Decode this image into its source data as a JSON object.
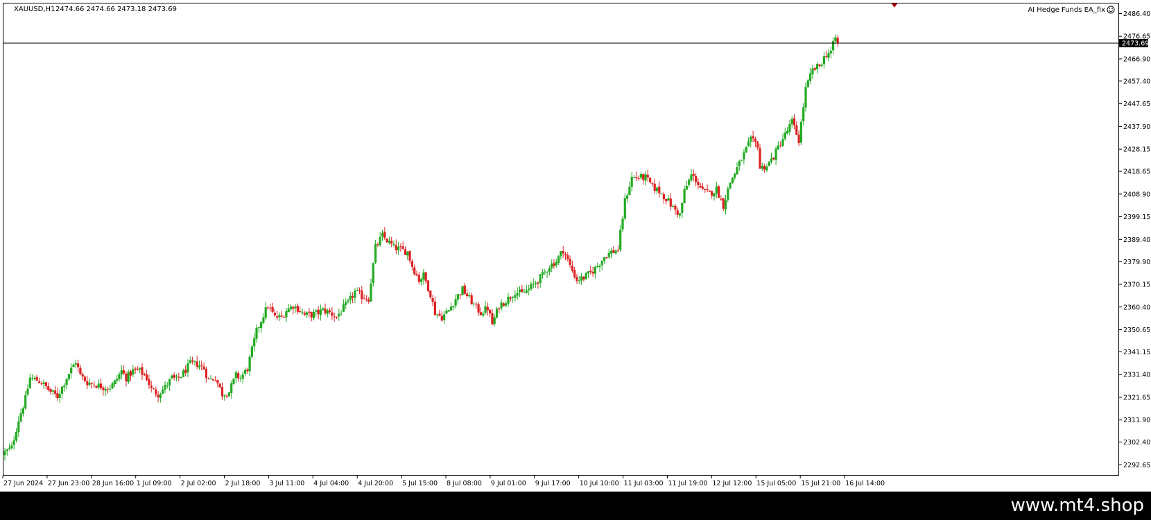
{
  "header": {
    "symbol": "XAUUSD,H1",
    "ohlc": "2474.66 2474.66 2473.18 2473.69",
    "ea_label": "AI Hedge Funds EA_fix",
    "smiley_icon": "smiley-face-icon"
  },
  "footer": {
    "watermark": "www.mt4.shop"
  },
  "colors": {
    "bull": "#22aa22",
    "bear": "#dd2222",
    "background": "#ffffff",
    "axis": "#000000",
    "price_label_bg": "#000000"
  },
  "chart_data": {
    "type": "candlestick",
    "timeframe": "H1",
    "current_price": 2473.69,
    "current_price_label": "2473.69",
    "ylim": [
      2288.0,
      2491.0
    ],
    "y_ticks": [
      "2486.40",
      "2476.65",
      "2466.90",
      "2457.40",
      "2447.65",
      "2437.90",
      "2428.15",
      "2418.65",
      "2408.90",
      "2399.15",
      "2389.40",
      "2379.90",
      "2370.15",
      "2360.40",
      "2350.65",
      "2341.15",
      "2331.40",
      "2321.65",
      "2311.90",
      "2302.40",
      "2292.65"
    ],
    "x_ticks": [
      "27 Jun 2024",
      "27 Jun 23:00",
      "28 Jun 16:00",
      "1 Jul 09:00",
      "2 Jul 02:00",
      "2 Jul 18:00",
      "3 Jul 11:00",
      "4 Jul 04:00",
      "4 Jul 20:00",
      "5 Jul 15:00",
      "8 Jul 08:00",
      "9 Jul 01:00",
      "9 Jul 17:00",
      "10 Jul 10:00",
      "11 Jul 03:00",
      "11 Jul 19:00",
      "12 Jul 12:00",
      "15 Jul 05:00",
      "15 Jul 21:00",
      "16 Jul 14:00"
    ],
    "path_points": [
      [
        0,
        2298
      ],
      [
        3,
        2300
      ],
      [
        6,
        2312
      ],
      [
        9,
        2321
      ],
      [
        11,
        2330
      ],
      [
        14,
        2329
      ],
      [
        16,
        2328
      ],
      [
        20,
        2324
      ],
      [
        23,
        2322
      ],
      [
        25,
        2326
      ],
      [
        28,
        2332
      ],
      [
        31,
        2337
      ],
      [
        33,
        2331
      ],
      [
        36,
        2328
      ],
      [
        40,
        2327
      ],
      [
        43,
        2326
      ],
      [
        46,
        2326
      ],
      [
        48,
        2328
      ],
      [
        51,
        2333
      ],
      [
        53,
        2330
      ],
      [
        56,
        2333
      ],
      [
        59,
        2333
      ],
      [
        62,
        2330
      ],
      [
        64,
        2325
      ],
      [
        67,
        2323
      ],
      [
        70,
        2326
      ],
      [
        73,
        2330
      ],
      [
        75,
        2329
      ],
      [
        78,
        2332
      ],
      [
        81,
        2336
      ],
      [
        84,
        2336
      ],
      [
        87,
        2334
      ],
      [
        89,
        2329
      ],
      [
        92,
        2330
      ],
      [
        95,
        2323
      ],
      [
        98,
        2324
      ],
      [
        101,
        2331
      ],
      [
        103,
        2330
      ],
      [
        106,
        2334
      ],
      [
        110,
        2350
      ],
      [
        113,
        2357
      ],
      [
        115,
        2361
      ],
      [
        118,
        2356
      ],
      [
        121,
        2356
      ],
      [
        123,
        2359
      ],
      [
        126,
        2361
      ],
      [
        129,
        2359
      ],
      [
        131,
        2357
      ],
      [
        134,
        2357
      ],
      [
        137,
        2358
      ],
      [
        139,
        2359
      ],
      [
        142,
        2358
      ],
      [
        145,
        2356
      ],
      [
        147,
        2359
      ],
      [
        150,
        2362
      ],
      [
        153,
        2367
      ],
      [
        156,
        2365
      ],
      [
        159,
        2364
      ],
      [
        162,
        2386
      ],
      [
        165,
        2391
      ],
      [
        167,
        2389
      ],
      [
        170,
        2386
      ],
      [
        173,
        2385
      ],
      [
        176,
        2384
      ],
      [
        178,
        2378
      ],
      [
        181,
        2372
      ],
      [
        183,
        2374
      ],
      [
        186,
        2366
      ],
      [
        188,
        2358
      ],
      [
        191,
        2356
      ],
      [
        194,
        2359
      ],
      [
        197,
        2364
      ],
      [
        200,
        2368
      ],
      [
        203,
        2364
      ],
      [
        206,
        2360
      ],
      [
        208,
        2358
      ],
      [
        211,
        2360
      ],
      [
        213,
        2353
      ],
      [
        216,
        2361
      ],
      [
        220,
        2364
      ],
      [
        223,
        2367
      ],
      [
        226,
        2366
      ],
      [
        229,
        2368
      ],
      [
        232,
        2371
      ],
      [
        235,
        2374
      ],
      [
        238,
        2378
      ],
      [
        241,
        2380
      ],
      [
        244,
        2385
      ],
      [
        247,
        2378
      ],
      [
        250,
        2372
      ],
      [
        253,
        2373
      ],
      [
        256,
        2375
      ],
      [
        259,
        2378
      ],
      [
        262,
        2382
      ],
      [
        265,
        2384
      ],
      [
        268,
        2385
      ],
      [
        271,
        2406
      ],
      [
        274,
        2416
      ],
      [
        277,
        2416
      ],
      [
        280,
        2416
      ],
      [
        283,
        2412
      ],
      [
        286,
        2410
      ],
      [
        289,
        2407
      ],
      [
        292,
        2403
      ],
      [
        295,
        2400
      ],
      [
        297,
        2410
      ],
      [
        300,
        2417
      ],
      [
        302,
        2415
      ],
      [
        305,
        2410
      ],
      [
        308,
        2409
      ],
      [
        311,
        2411
      ],
      [
        314,
        2404
      ],
      [
        317,
        2414
      ],
      [
        320,
        2420
      ],
      [
        323,
        2426
      ],
      [
        326,
        2432
      ],
      [
        329,
        2430
      ],
      [
        330,
        2420
      ],
      [
        333,
        2421
      ],
      [
        336,
        2425
      ],
      [
        339,
        2431
      ],
      [
        342,
        2436
      ],
      [
        344,
        2440
      ],
      [
        347,
        2432
      ],
      [
        350,
        2454
      ],
      [
        353,
        2462
      ],
      [
        356,
        2464
      ],
      [
        359,
        2469
      ],
      [
        361,
        2470
      ],
      [
        363,
        2476
      ],
      [
        364,
        2473.69
      ]
    ]
  }
}
